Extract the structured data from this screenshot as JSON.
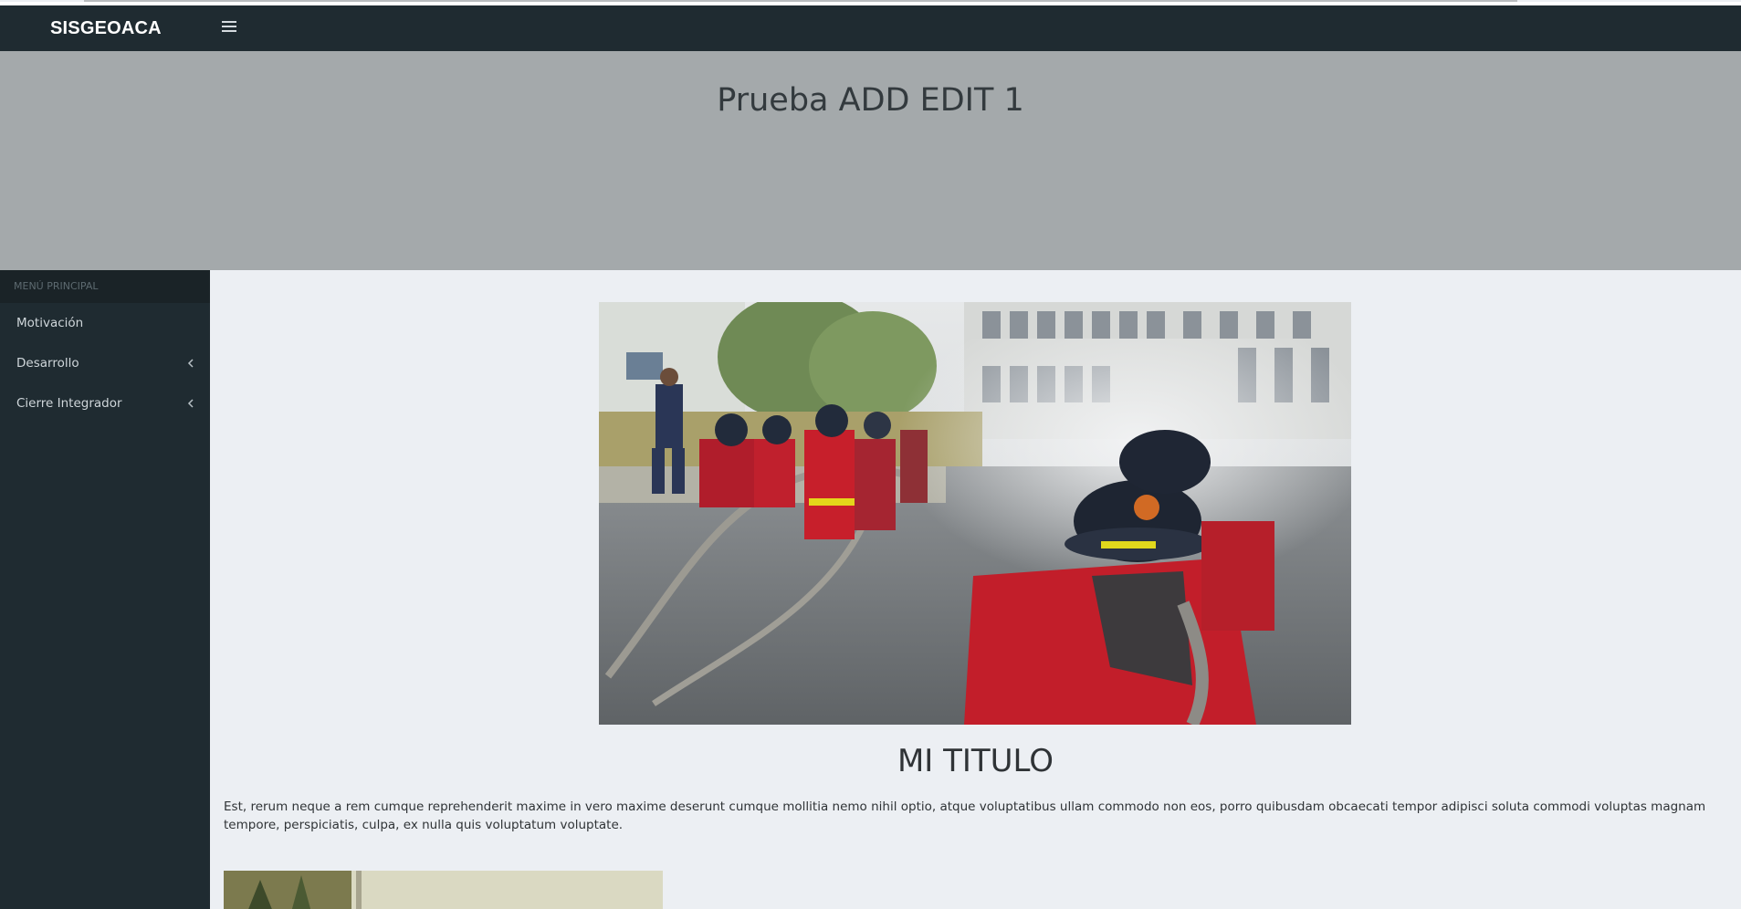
{
  "app": {
    "brand": "SISGEOACA"
  },
  "header": {
    "title": "Prueba ADD EDIT 1"
  },
  "sidebar": {
    "header": "MENÚ PRINCIPAL",
    "items": [
      {
        "label": "Motivación",
        "has_children": false
      },
      {
        "label": "Desarrollo",
        "has_children": true
      },
      {
        "label": "Cierre Integrador",
        "has_children": true
      }
    ]
  },
  "main": {
    "card_title": "MI TITULO",
    "card_text": "Est, rerum neque a rem cumque reprehenderit maxime in vero maxime deserunt cumque mollitia nemo nihil optio, atque voluptatibus ullam commodo non eos, porro quibusdam obcaecati tempor adipisci soluta commodi voluptas magnam tempore, perspiciatis, culpa, ex nulla quis voluptatum voluptate."
  },
  "colors": {
    "navbar": "#1f2b31",
    "header_band": "#a4a9ab",
    "content_bg": "#eceff3",
    "sidebar_bg": "#1f2b31"
  },
  "icons": {
    "menu_toggle": "hamburger-icon",
    "submenu": "chevron-left-icon"
  }
}
